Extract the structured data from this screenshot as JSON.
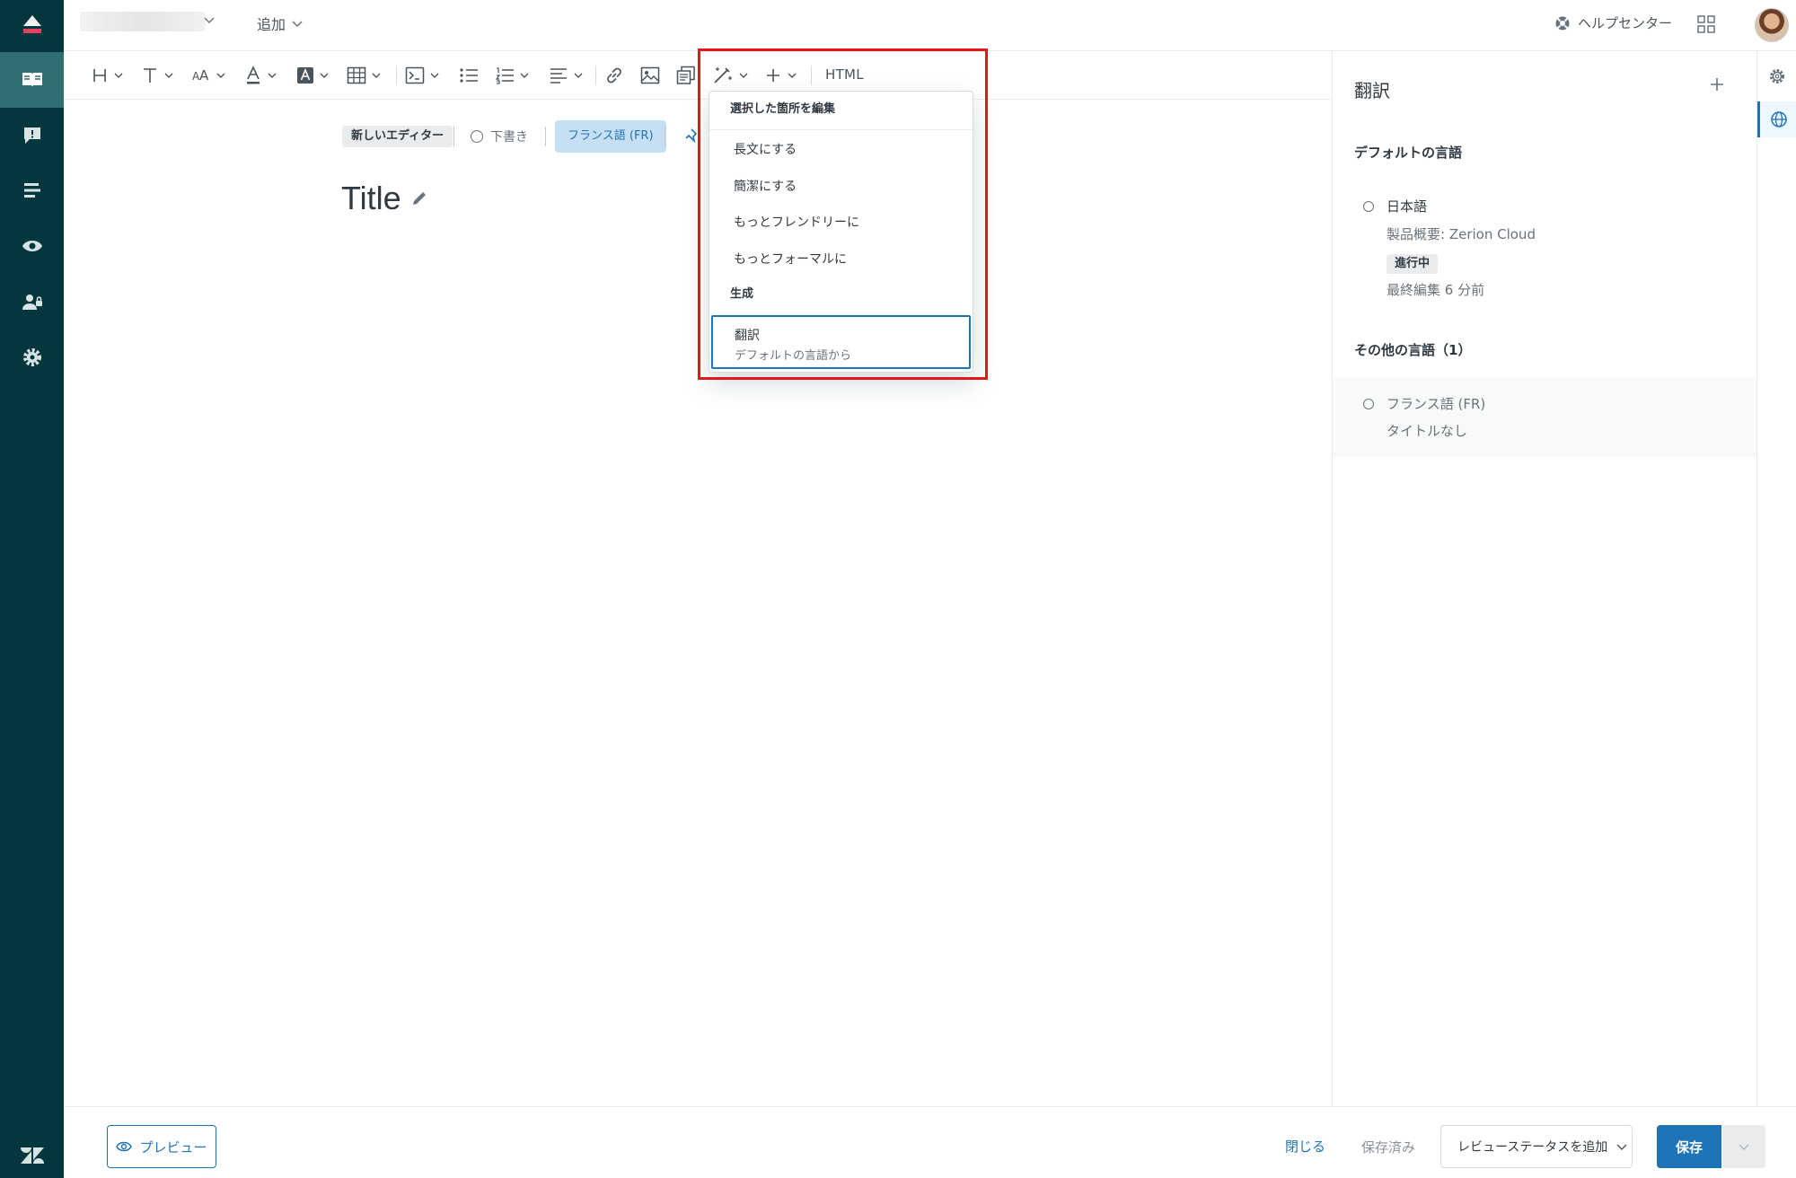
{
  "header": {
    "add_label": "追加",
    "helpcenter_label": "ヘルプセンター"
  },
  "toolbar": {
    "html_label": "HTML"
  },
  "editor": {
    "new_editor_label": "新しいエディター",
    "draft_label": "下書き",
    "lang_chip_label": "フランス語 (FR)",
    "title": "Title"
  },
  "ai_menu": {
    "section_edit": "選択した箇所を編集",
    "items": [
      "長文にする",
      "簡潔にする",
      "もっとフレンドリーに",
      "もっとフォーマルに"
    ],
    "section_generate": "生成",
    "translate_label": "翻訳",
    "translate_sub": "デフォルトの言語から"
  },
  "translations_panel": {
    "title": "翻訳",
    "default_lang_heading": "デフォルトの言語",
    "default_lang": {
      "name": "日本語",
      "article": "製品概要: Zerion Cloud",
      "status": "進行中",
      "last_edited": "最終編集 6 分前"
    },
    "other_lang_heading": "その他の言語（1）",
    "other_lang": {
      "name": "フランス語 (FR)",
      "article": "タイトルなし"
    }
  },
  "footer": {
    "preview_label": "プレビュー",
    "close_label": "閉じる",
    "saved_label": "保存済み",
    "review_status_label": "レビューステータスを追加",
    "save_label": "保存"
  },
  "colors": {
    "nav_bg": "#03363d",
    "accent": "#1f73b7",
    "highlight": "#e3161a"
  },
  "icons": [
    "knowledge-icon",
    "feedback-icon",
    "list-icon",
    "eye-icon",
    "team-icon",
    "gear-icon",
    "zendesk-logo-icon"
  ]
}
